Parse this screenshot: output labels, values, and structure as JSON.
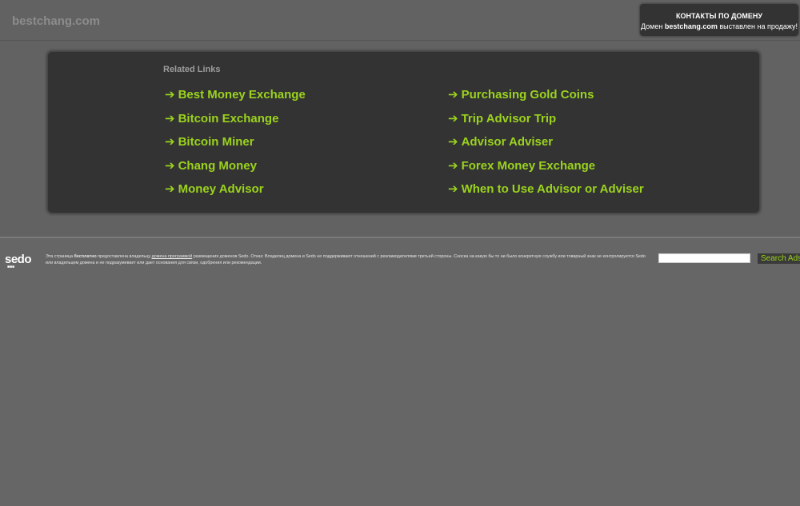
{
  "header": {
    "domain": "bestchang.com"
  },
  "contact": {
    "title": "КОНТАКТЫ ПО ДОМЕНУ",
    "prefix": "Домен",
    "domain": "bestchang.com",
    "suffix": "выставлен на продажу!"
  },
  "related": {
    "heading": "Related Links",
    "arrow": "➔",
    "left": [
      "Best Money Exchange",
      "Bitcoin Exchange",
      "Bitcoin Miner",
      "Chang Money",
      "Money Advisor"
    ],
    "right": [
      "Purchasing Gold Coins",
      "Trip Advisor Trip",
      "Advisor Adviser",
      "Forex Money Exchange",
      "When to Use Advisor or Adviser"
    ]
  },
  "footer": {
    "logo": "sedo",
    "logo_dots": "■■■",
    "disclaimer_part1": "Эта страница",
    "disclaimer_bold": "бесплатно",
    "disclaimer_part2": "предоставлена владельцу",
    "disclaimer_link": "домена программой",
    "disclaimer_part3": "размещения доменов Sedo. Отказ: Владелец домена и Sedo не поддерживают отношений с рекламодателями третьей стороны. Сноска на какую бы то ни было конкретную службу или товарный знак не контролируется Sedo или владельцем домена и не подразумевает или дает основания для связи, одобрения или рекомендации.",
    "search_placeholder": "",
    "search_button": "Search Ads"
  },
  "colors": {
    "background": "#626262",
    "panel": "#333333",
    "link": "#9bd31d",
    "heading": "#9c9c9c",
    "domain_title": "#8c8c8c"
  }
}
